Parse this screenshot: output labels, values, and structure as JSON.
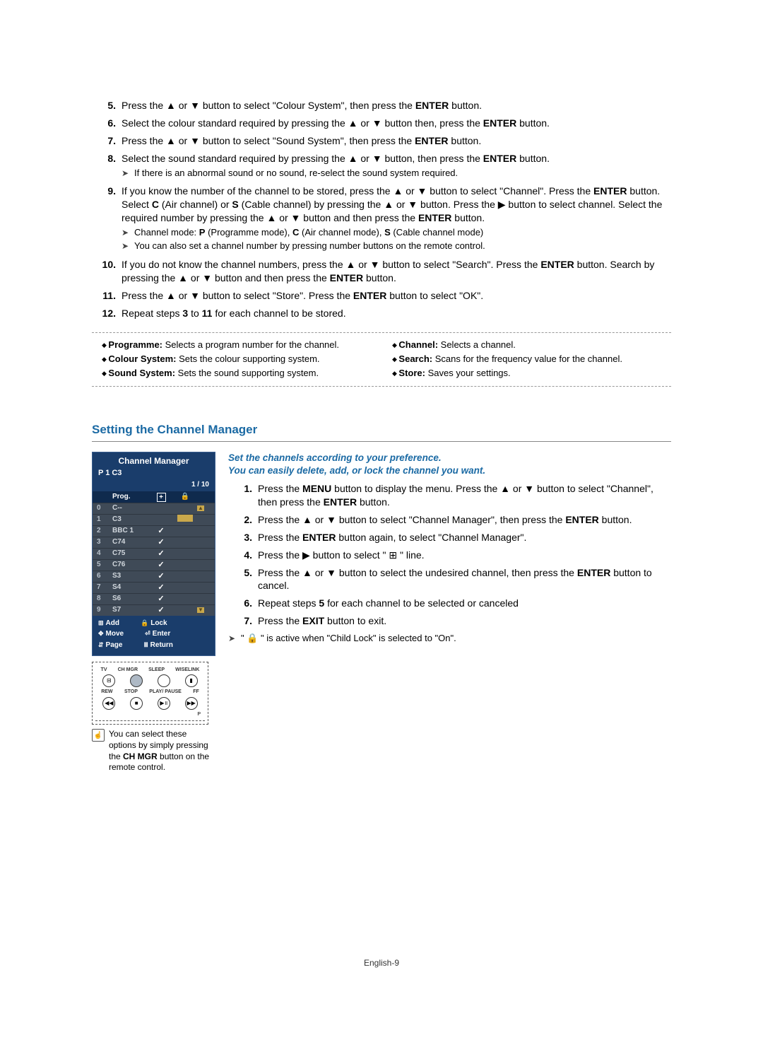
{
  "steps_a": [
    {
      "n": "5.",
      "text": "Press the ▲ or ▼ button to select \"Colour System\", then press the <b>ENTER</b> button."
    },
    {
      "n": "6.",
      "text": "Select the colour standard required by pressing the ▲ or ▼ button then, press the <b>ENTER</b> button."
    },
    {
      "n": "7.",
      "text": "Press the ▲ or ▼ button to select \"Sound System\", then press the <b>ENTER</b> button."
    },
    {
      "n": "8.",
      "text": "Select the sound standard required by pressing the ▲ or ▼ button, then press the <b>ENTER</b> button.",
      "sub": [
        {
          "icon": "➤",
          "text": "If there is an abnormal sound or no sound, re-select the sound system required."
        }
      ]
    },
    {
      "n": "9.",
      "text": "If you know the number of the channel to be stored, press the ▲ or ▼ button to select \"Channel\". Press the <b>ENTER</b> button. Select <b>C</b> (Air channel) or <b>S</b> (Cable channel) by pressing the ▲ or ▼ button. Press the ▶ button to select channel. Select the required number by pressing the ▲ or ▼ button and then press the <b>ENTER</b> button.",
      "sub": [
        {
          "icon": "➤",
          "text": "Channel mode: <b>P</b> (Programme mode), <b>C</b> (Air channel mode), <b>S</b> (Cable channel mode)"
        },
        {
          "icon": "➤",
          "text": "You can also set a channel number by pressing number buttons on the remote control."
        }
      ]
    },
    {
      "n": "10.",
      "text": "If you do not know the channel numbers, press the ▲ or ▼ button to select \"Search\". Press the <b>ENTER</b> button. Search by pressing the ▲ or ▼ button and then press the <b>ENTER</b> button."
    },
    {
      "n": "11.",
      "text": "Press the ▲ or ▼ button to select \"Store\". Press the <b>ENTER</b> button to select \"OK\"."
    },
    {
      "n": "12.",
      "text": "Repeat steps <b>3</b> to <b>11</b> for each channel to be stored."
    }
  ],
  "defs_left": [
    {
      "term": "Programme:",
      "text": " Selects a program number for the channel."
    },
    {
      "term": "Colour System:",
      "text": " Sets the colour supporting system."
    },
    {
      "term": "Sound System:",
      "text": " Sets the sound supporting system."
    }
  ],
  "defs_right": [
    {
      "term": "Channel:",
      "text": " Selects a channel."
    },
    {
      "term": "Search:",
      "text": " Scans for the frequency value for the channel."
    },
    {
      "term": "Store:",
      "text": " Saves your settings."
    }
  ],
  "section_title": "Setting the Channel Manager",
  "intro_line1": "Set the channels according to your preference.",
  "intro_line2": "You can easily delete, add, or lock the channel you want.",
  "steps_b": [
    {
      "n": "1.",
      "text": "Press the <b>MENU</b> button to display the menu.  Press the ▲ or ▼ button to select \"Channel\", then press the <b>ENTER</b> button."
    },
    {
      "n": "2.",
      "text": "Press the ▲ or ▼ button to select \"Channel Manager\", then press the <b>ENTER</b> button."
    },
    {
      "n": "3.",
      "text": "Press the <b>ENTER</b> button again, to select \"Channel Manager\"."
    },
    {
      "n": "4.",
      "text": "Press the ▶ button to select \" ⊞ \" line."
    },
    {
      "n": "5.",
      "text": "Press the ▲ or ▼ button to select the undesired channel, then press the <b>ENTER</b> button to cancel."
    },
    {
      "n": "6.",
      "text": "Repeat steps <b>5</b> for each channel to be selected or canceled"
    },
    {
      "n": "7.",
      "text": "Press the <b>EXIT</b> button to exit."
    }
  ],
  "note_lock": "\" 🔒 \" is active when \"Child Lock\" is selected to \"On\".",
  "cm": {
    "title": "Channel Manager",
    "current": "P 1   C3",
    "counter": "1 / 10",
    "head_prog": "Prog.",
    "rows": [
      {
        "idx": "0",
        "name": "C--",
        "chk": false,
        "hl": false
      },
      {
        "idx": "1",
        "name": "C3",
        "chk": false,
        "hl": true
      },
      {
        "idx": "2",
        "name": "BBC 1",
        "chk": true,
        "hl": false
      },
      {
        "idx": "3",
        "name": "C74",
        "chk": true,
        "hl": false
      },
      {
        "idx": "4",
        "name": "C75",
        "chk": true,
        "hl": false
      },
      {
        "idx": "5",
        "name": "C76",
        "chk": true,
        "hl": false
      },
      {
        "idx": "6",
        "name": "S3",
        "chk": true,
        "hl": false
      },
      {
        "idx": "7",
        "name": "S4",
        "chk": true,
        "hl": false
      },
      {
        "idx": "8",
        "name": "S6",
        "chk": true,
        "hl": false
      },
      {
        "idx": "9",
        "name": "S7",
        "chk": true,
        "hl": false
      }
    ],
    "foot_add": "Add",
    "foot_lock": "Lock",
    "foot_move": "Move",
    "foot_enter": "Enter",
    "foot_page": "Page",
    "foot_return": "Return"
  },
  "remote_labels": [
    "TV",
    "CH MGR",
    "SLEEP",
    "WISELINK"
  ],
  "remote_labels2": [
    "REW",
    "STOP",
    "PLAY/\nPAUSE",
    "FF"
  ],
  "remote_note": "You can select these options  by simply pressing the  <b>CH MGR</b> button on the remote control.",
  "page_footer": "English-9"
}
